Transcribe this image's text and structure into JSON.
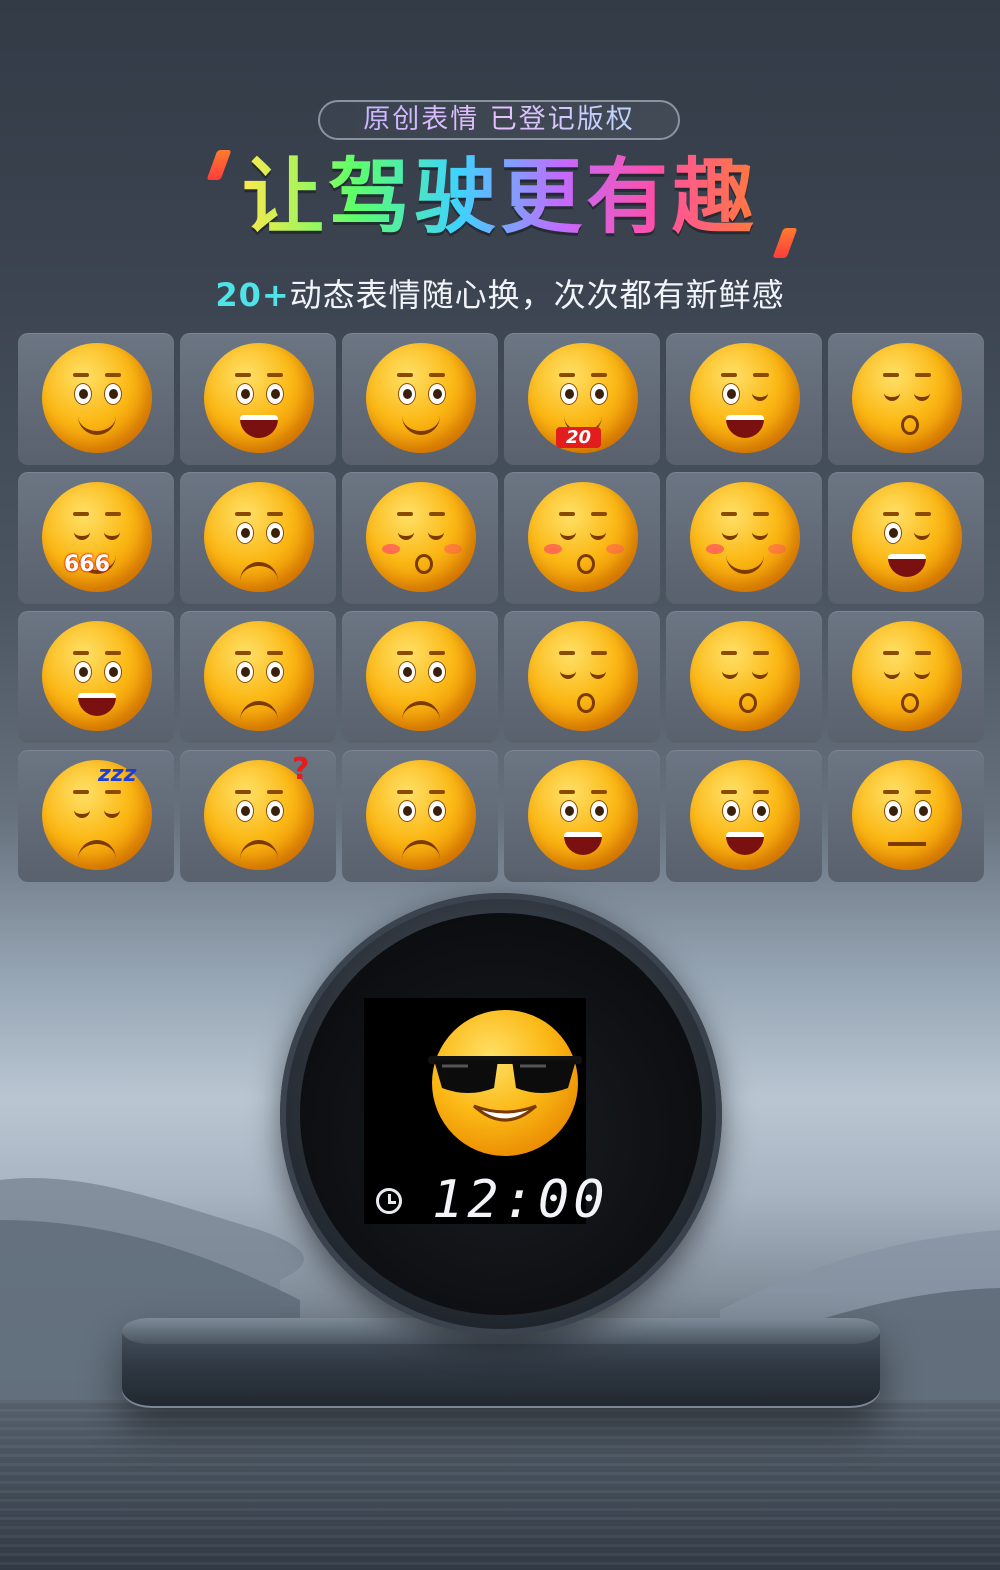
{
  "header": {
    "badge": "原创表情 已登记版权",
    "title": "让驾驶更有趣",
    "subtitle_highlight": "20+",
    "subtitle_rest": "动态表情随心换，次次都有新鲜感"
  },
  "emoji_grid": {
    "items": [
      {
        "name": "smiling-face-icon",
        "prop": ""
      },
      {
        "name": "grinning-face-icon",
        "prop": ""
      },
      {
        "name": "side-glance-face-icon",
        "prop": ""
      },
      {
        "name": "face-with-sign-icon",
        "prop": "20"
      },
      {
        "name": "winking-tongue-face-icon",
        "prop": ""
      },
      {
        "name": "puffed-cheeks-face-icon",
        "prop": ""
      },
      {
        "name": "smirk-thumbs-up-face-icon",
        "prop": "666"
      },
      {
        "name": "headband-determined-face-icon",
        "prop": ""
      },
      {
        "name": "kissing-closed-eyes-face-icon",
        "prop": ""
      },
      {
        "name": "blowing-hearts-face-icon",
        "prop": ""
      },
      {
        "name": "blushing-smile-face-icon",
        "prop": ""
      },
      {
        "name": "zany-face-icon",
        "prop": ""
      },
      {
        "name": "screaming-face-icon",
        "prop": ""
      },
      {
        "name": "teary-sad-face-icon",
        "prop": ""
      },
      {
        "name": "sweating-worried-face-icon",
        "prop": ""
      },
      {
        "name": "party-glowstick-face-icon",
        "prop": ""
      },
      {
        "name": "party-glowstick-face-2-icon",
        "prop": ""
      },
      {
        "name": "yawning-face-icon",
        "prop": ""
      },
      {
        "name": "sleeping-face-icon",
        "prop": "zzz"
      },
      {
        "name": "confused-face-icon",
        "prop": "?"
      },
      {
        "name": "anxious-face-icon",
        "prop": ""
      },
      {
        "name": "angry-grimace-face-icon",
        "prop": ""
      },
      {
        "name": "drooling-face-icon",
        "prop": ""
      },
      {
        "name": "thinking-face-icon",
        "prop": ""
      }
    ]
  },
  "device": {
    "time": "12:00",
    "icon": "clock-icon",
    "screen_emoji": "sunglasses-face-icon"
  }
}
